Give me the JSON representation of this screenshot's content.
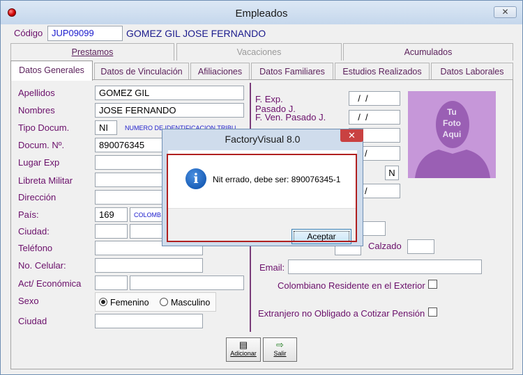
{
  "window": {
    "title": "Empleados",
    "close_glyph": "✕"
  },
  "header": {
    "codigo_label": "Código",
    "codigo_value": "JUP09099",
    "employee_name": "GOMEZ GIL JOSE FERNANDO"
  },
  "tabs_top": [
    {
      "label": "Prestamos",
      "enabled": true
    },
    {
      "label": "Vacaciones",
      "enabled": false
    },
    {
      "label": "Acumulados",
      "enabled": true
    }
  ],
  "tabs_bottom": [
    {
      "label": "Datos Generales",
      "active": true
    },
    {
      "label": "Datos de Vinculación",
      "active": false
    },
    {
      "label": "Afiliaciones",
      "active": false
    },
    {
      "label": "Datos Familiares",
      "active": false
    },
    {
      "label": "Estudios Realizados",
      "active": false
    },
    {
      "label": "Datos Laborales",
      "active": false
    }
  ],
  "form": {
    "apellidos": {
      "label": "Apellidos",
      "value": "GOMEZ GIL"
    },
    "nombres": {
      "label": "Nombres",
      "value": "JOSE FERNANDO"
    },
    "tipo_docum": {
      "label": "Tipo Docum.",
      "value": "NI",
      "desc": "NUMERO DE IDENTIFICACION TRIBU"
    },
    "docum_no": {
      "label": "Docum. Nº.",
      "value": "890076345"
    },
    "lugar_exp": {
      "label": "Lugar Exp"
    },
    "libreta_militar": {
      "label": "Libreta Militar"
    },
    "direccion": {
      "label": "Dirección"
    },
    "pais": {
      "label": "País:",
      "code": "169",
      "name": "COLOMB"
    },
    "ciudad_colon": {
      "label": "Ciudad:"
    },
    "telefono": {
      "label": "Teléfono"
    },
    "celular": {
      "label": "No. Celular:"
    },
    "act_economica": {
      "label": "Act/ Económica"
    },
    "sexo": {
      "label": "Sexo",
      "options": [
        "Femenino",
        "Masculino"
      ],
      "selected": "Femenino"
    },
    "ciudad": {
      "label": "Ciudad"
    }
  },
  "right": {
    "f_exp": {
      "label": "F. Exp.",
      "value": "  /  /"
    },
    "pasado_j": {
      "label": "Pasado J."
    },
    "f_ven_pasado": {
      "label": "F. Ven. Pasado J.",
      "value": "  /  /"
    },
    "hidden_slash_1": "/",
    "n_value": "N",
    "hidden_slash_2": "/",
    "calzado": {
      "label": "Calzado"
    },
    "email": {
      "label": "Email:"
    },
    "colombiano_residente": {
      "label": "Colombiano Residente en el Exterior",
      "checked": false
    },
    "extranjero": {
      "label": "Extranjero no Obligado a Cotizar Pensión",
      "checked": false
    },
    "photo_text": [
      "Tu",
      "Foto",
      "Aqui"
    ]
  },
  "toolbar": {
    "adicionar": "Adicionar",
    "salir": "Salir"
  },
  "dialog": {
    "title": "FactoryVisual 8.0",
    "close_glyph": "✕",
    "message": "Nit errado, debe ser: 890076345-1",
    "ok_label": "Aceptar"
  },
  "colors": {
    "label": "#6a0f6a",
    "accent_red": "#b02020",
    "info_blue": "#1a5fb8",
    "photo_bg": "#c697d9"
  }
}
